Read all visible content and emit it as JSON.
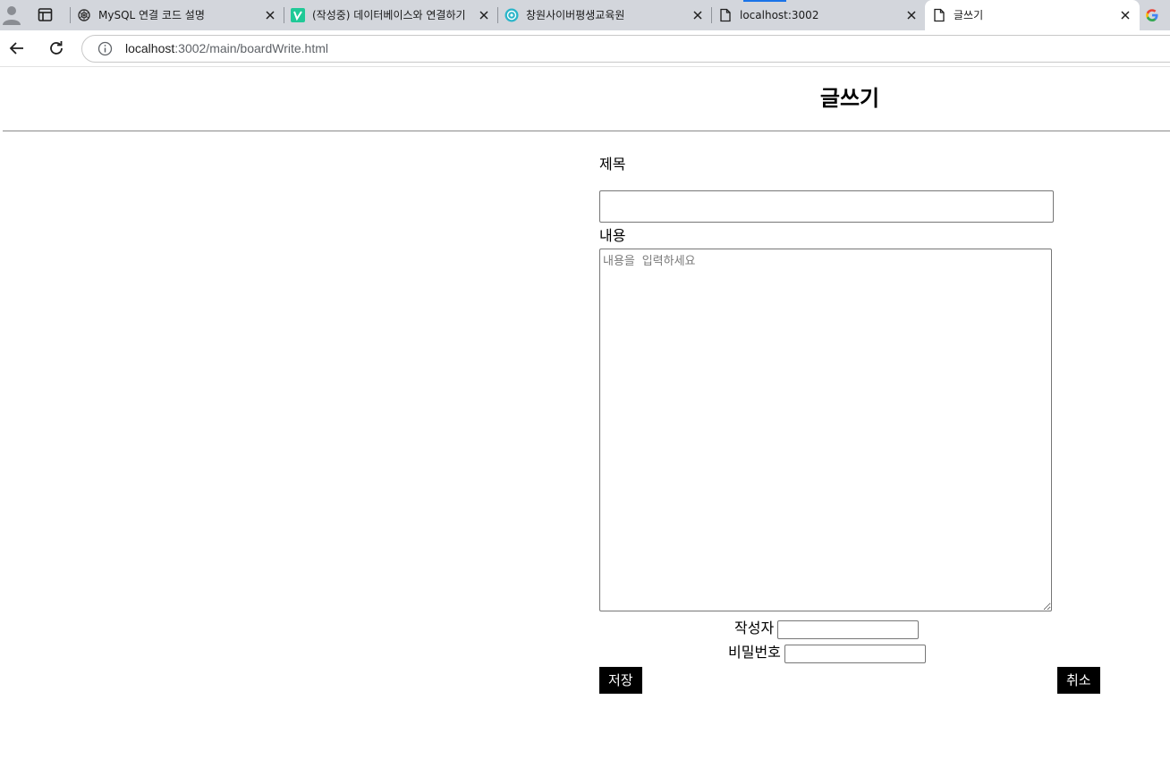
{
  "browser": {
    "tabs": [
      {
        "title": "MySQL 연결 코드 설명",
        "icon": "openai-icon",
        "active": false
      },
      {
        "title": "(작성중) 데이터베이스와 연결하기",
        "icon": "velog-icon",
        "active": false
      },
      {
        "title": "창원사이버평생교육원",
        "icon": "cyber-edu-icon",
        "active": false
      },
      {
        "title": "localhost:3002",
        "icon": "page-icon",
        "active": false
      },
      {
        "title": "글쓰기",
        "icon": "page-icon",
        "active": true
      }
    ],
    "address": {
      "host": "localhost",
      "path": ":3002/main/boardWrite.html"
    },
    "colors": {
      "tabstrip": "#d3d6dc",
      "accent": "#1a73e8"
    }
  },
  "page": {
    "heading": "글쓰기",
    "title_label": "제목",
    "title_value": "",
    "content_label": "내용",
    "content_placeholder": "내용을 입력하세요",
    "author_label": "작성자",
    "author_value": "",
    "password_label": "비밀번호",
    "password_value": "",
    "save_button": "저장",
    "cancel_button": "취소"
  }
}
